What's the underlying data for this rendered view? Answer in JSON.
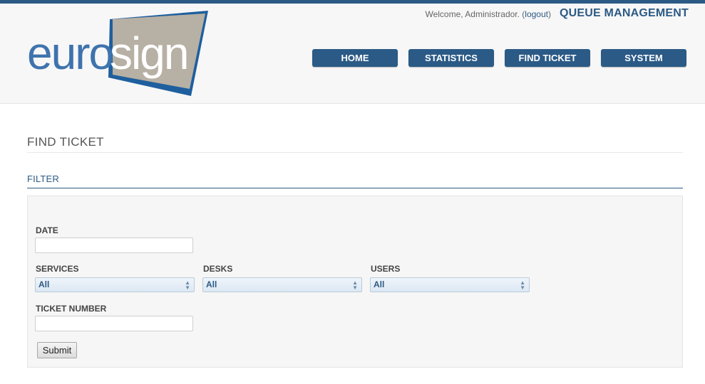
{
  "header": {
    "welcome_text": "Welcome, Administrador. (",
    "logout_label": "logout",
    "welcome_suffix": ")",
    "app_title": "QUEUE MANAGEMENT",
    "logo_text_euro": "euro",
    "logo_text_sign": "sign"
  },
  "nav": {
    "items": [
      {
        "label": "HOME"
      },
      {
        "label": "STATISTICS"
      },
      {
        "label": "FIND TICKET"
      },
      {
        "label": "SYSTEM"
      }
    ]
  },
  "page": {
    "title": "FIND TICKET",
    "section_title": "FILTER"
  },
  "filter": {
    "date_label": "DATE",
    "date_value": "",
    "services_label": "SERVICES",
    "services_value": "All",
    "desks_label": "DESKS",
    "desks_value": "All",
    "users_label": "USERS",
    "users_value": "All",
    "ticket_number_label": "TICKET NUMBER",
    "ticket_number_value": "",
    "submit_label": "Submit"
  },
  "colors": {
    "brand": "#2c5a85",
    "logo_euro": "#3f73ad",
    "logo_sign": "#ffffff",
    "logo_box": "#b7b0a4"
  }
}
